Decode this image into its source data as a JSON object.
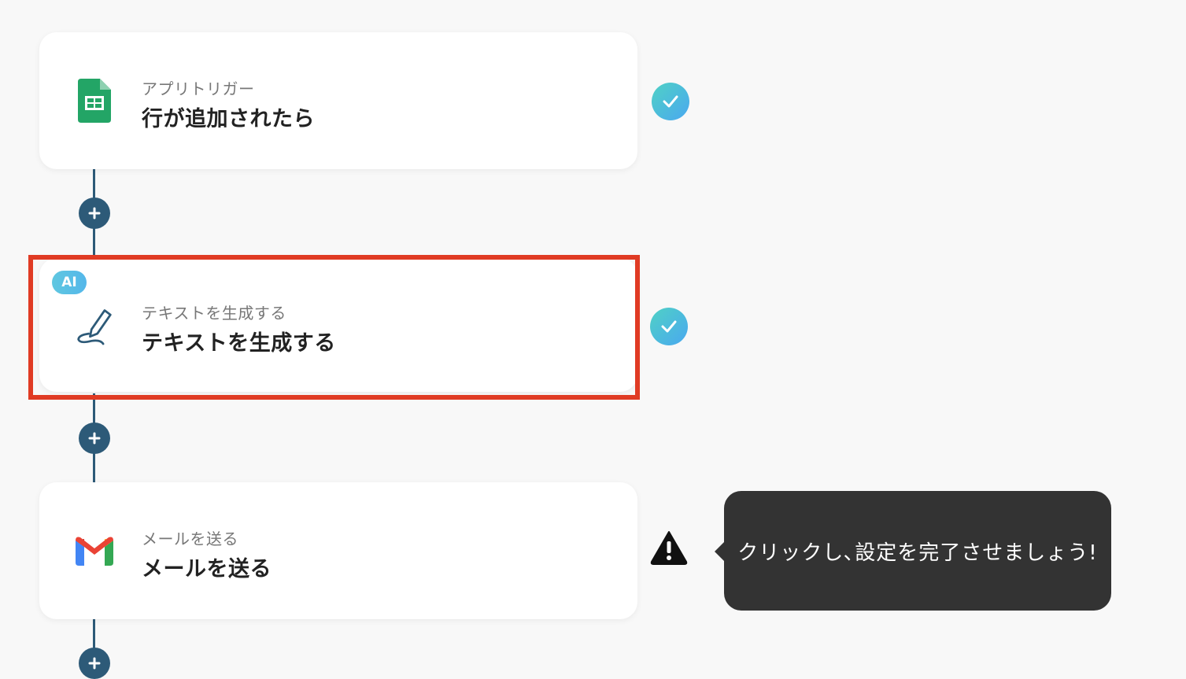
{
  "colors": {
    "connector": "#2d5a78",
    "highlight": "#e03b24",
    "tooltip_bg": "#333333"
  },
  "steps": [
    {
      "icon": "google-sheets-icon",
      "subtitle": "アプリトリガー",
      "title": "行が追加されたら",
      "status": "complete"
    },
    {
      "icon": "pen-icon",
      "badge": "AI",
      "subtitle": "テキストを生成する",
      "title": "テキストを生成する",
      "status": "complete",
      "highlighted": true
    },
    {
      "icon": "gmail-icon",
      "subtitle": "メールを送る",
      "title": "メールを送る",
      "status": "warning"
    }
  ],
  "tooltip": {
    "text": "クリックし､設定を完了させましょう!"
  }
}
